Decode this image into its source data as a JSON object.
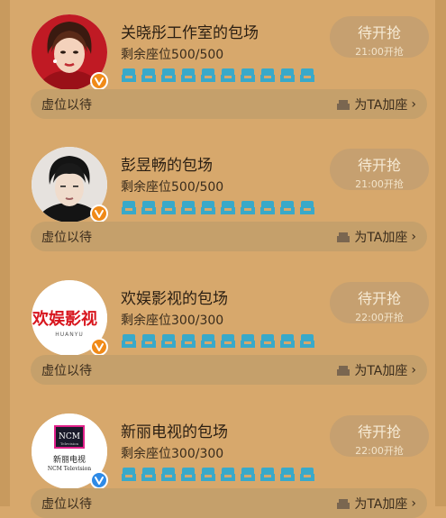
{
  "rooms": [
    {
      "title": "关晓彤工作室的包场",
      "seats": "剩余座位500/500",
      "grab_label": "待开抢",
      "grab_time": "21:00开抢",
      "waiting": "虚位以待",
      "add_seat": "为TA加座",
      "chevron": "›",
      "badge": "orange-v",
      "avatar_icon": "portrait-woman"
    },
    {
      "title": "彭昱畅的包场",
      "seats": "剩余座位500/500",
      "grab_label": "待开抢",
      "grab_time": "21:00开抢",
      "waiting": "虚位以待",
      "add_seat": "为TA加座",
      "chevron": "›",
      "badge": "orange-v",
      "avatar_icon": "portrait-man"
    },
    {
      "title": "欢娱影视的包场",
      "seats": "剩余座位300/300",
      "grab_label": "待开抢",
      "grab_time": "22:00开抢",
      "waiting": "虚位以待",
      "add_seat": "为TA加座",
      "chevron": "›",
      "badge": "orange-v",
      "avatar_icon": "huanyu-logo",
      "logo_text": "欢娱影视",
      "logo_sub": "HUANYU"
    },
    {
      "title": "新丽电视的包场",
      "seats": "剩余座位300/300",
      "grab_label": "待开抢",
      "grab_time": "22:00开抢",
      "waiting": "虚位以待",
      "add_seat": "为TA加座",
      "chevron": "›",
      "badge": "blue-v",
      "avatar_icon": "ncm-logo",
      "logo_text": "NCM",
      "logo_sub": "Television",
      "logo_cn": "新丽电视",
      "logo_en": "NCM Television"
    }
  ],
  "colors": {
    "background": "#d7a86c",
    "bar": "#c5a06b",
    "button": "#c6a070",
    "seat": "#39a9c9",
    "badge_orange": "#f08a18",
    "badge_blue": "#2e8ae6"
  }
}
